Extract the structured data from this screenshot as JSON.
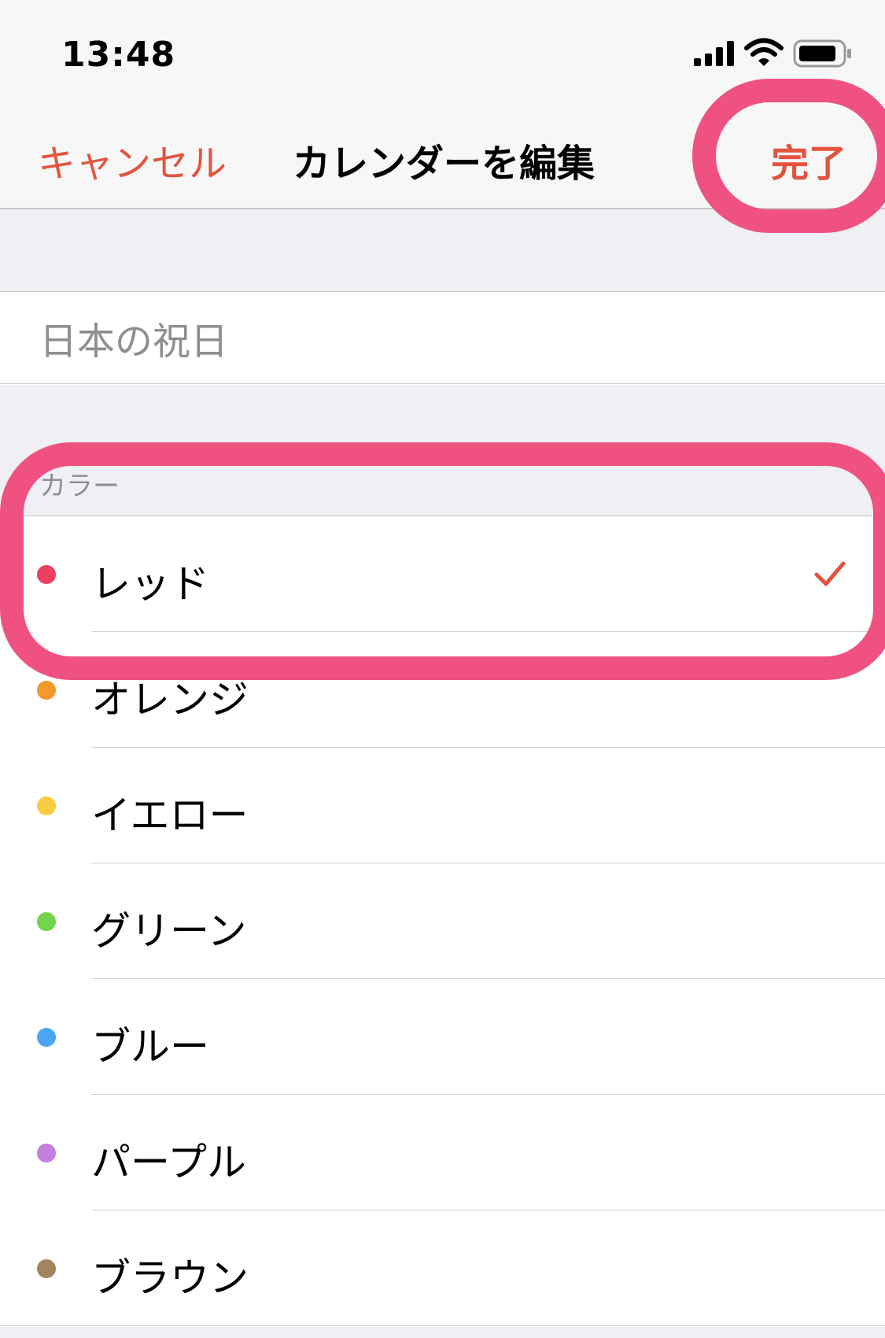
{
  "status_bar": {
    "time": "13:48"
  },
  "nav": {
    "cancel_label": "キャンセル",
    "title": "カレンダーを編集",
    "done_label": "完了",
    "accent_color": "#e4533e"
  },
  "calendar_name": {
    "value": "日本の祝日"
  },
  "color_section": {
    "header": "カラー",
    "selected": "レッド",
    "items": [
      {
        "label": "レッド",
        "color": "#ec3f60",
        "selected": true
      },
      {
        "label": "オレンジ",
        "color": "#f4982d",
        "selected": false
      },
      {
        "label": "イエロー",
        "color": "#f7cd3f",
        "selected": false
      },
      {
        "label": "グリーン",
        "color": "#72d34d",
        "selected": false
      },
      {
        "label": "ブルー",
        "color": "#4ba5f0",
        "selected": false
      },
      {
        "label": "パープル",
        "color": "#c57fe0",
        "selected": false
      },
      {
        "label": "ブラウン",
        "color": "#a2845e",
        "selected": false
      }
    ]
  },
  "annotation_color": "#ef5181"
}
